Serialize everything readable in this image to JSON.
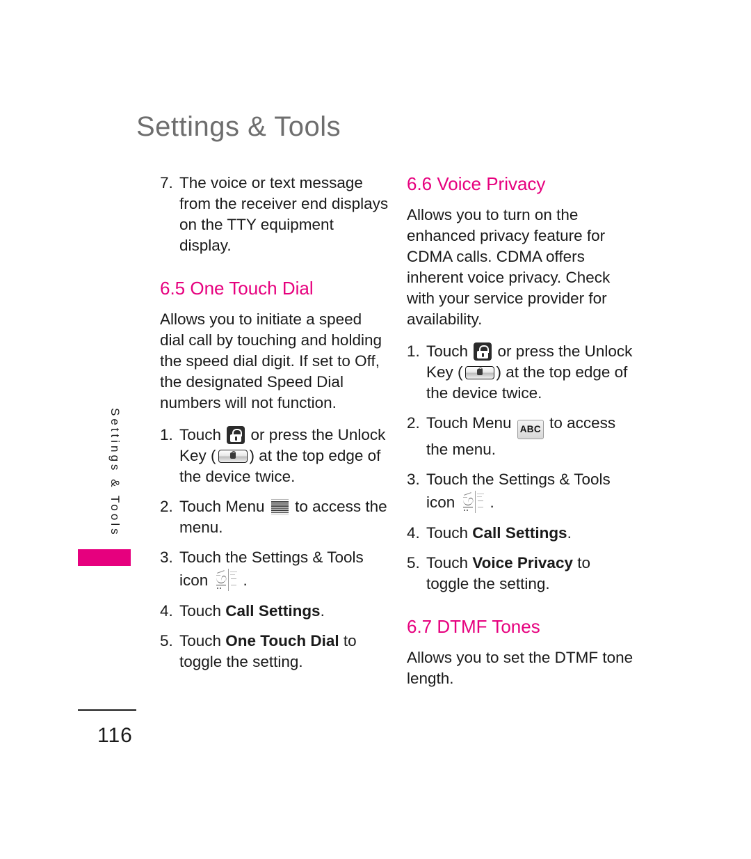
{
  "page": {
    "title": "Settings & Tools",
    "side_tab_label": "Settings & Tools",
    "page_number": "116",
    "accent_color": "#e6007e",
    "title_color": "#6e6e6e"
  },
  "icons": {
    "lock": "lock-icon",
    "unlock_key": "unlock-key-icon",
    "menu_list": "menu-list-icon",
    "abc_keypad": "ABC",
    "settings_tools": "settings-tools-icon"
  },
  "left_column": {
    "step7": {
      "num": "7.",
      "text": "The voice or text message from the receiver end displays on the TTY equipment display."
    },
    "heading_65": "6.5 One Touch Dial",
    "intro_65": "Allows you to initiate a speed dial call by touching and holding the speed dial digit. If set to Off, the designated Speed Dial numbers will not function.",
    "steps": {
      "s1_num": "1.",
      "s1_a": "Touch ",
      "s1_b": " or press the Unlock Key (",
      "s1_c": ") at the top edge of the device twice.",
      "s2_num": "2.",
      "s2_a": "Touch Menu ",
      "s2_b": " to access the menu.",
      "s3_num": "3.",
      "s3_a": "Touch the Settings & Tools icon ",
      "s3_b": ".",
      "s4_num": "4.",
      "s4_a": "Touch ",
      "s4_bold": "Call Settings",
      "s4_b": ".",
      "s5_num": "5.",
      "s5_a": "Touch ",
      "s5_bold": "One Touch Dial",
      "s5_b": " to toggle the setting."
    }
  },
  "right_column": {
    "heading_66": "6.6 Voice Privacy",
    "intro_66": "Allows you to turn on the enhanced privacy feature for CDMA calls. CDMA offers inherent voice privacy. Check with your service provider for availability.",
    "steps": {
      "s1_num": "1.",
      "s1_a": "Touch ",
      "s1_b": " or press the Unlock Key (",
      "s1_c": ") at the top edge of the device twice.",
      "s2_num": "2.",
      "s2_a": "Touch Menu ",
      "s2_b": " to access the menu.",
      "s3_num": "3.",
      "s3_a": "Touch the Settings & Tools icon ",
      "s3_b": ".",
      "s4_num": "4.",
      "s4_a": "Touch ",
      "s4_bold": "Call Settings",
      "s4_b": ".",
      "s5_num": "5.",
      "s5_a": "Touch ",
      "s5_bold": "Voice Privacy",
      "s5_b": " to toggle the setting."
    },
    "heading_67": "6.7 DTMF Tones",
    "intro_67": "Allows you to set the DTMF tone length."
  }
}
